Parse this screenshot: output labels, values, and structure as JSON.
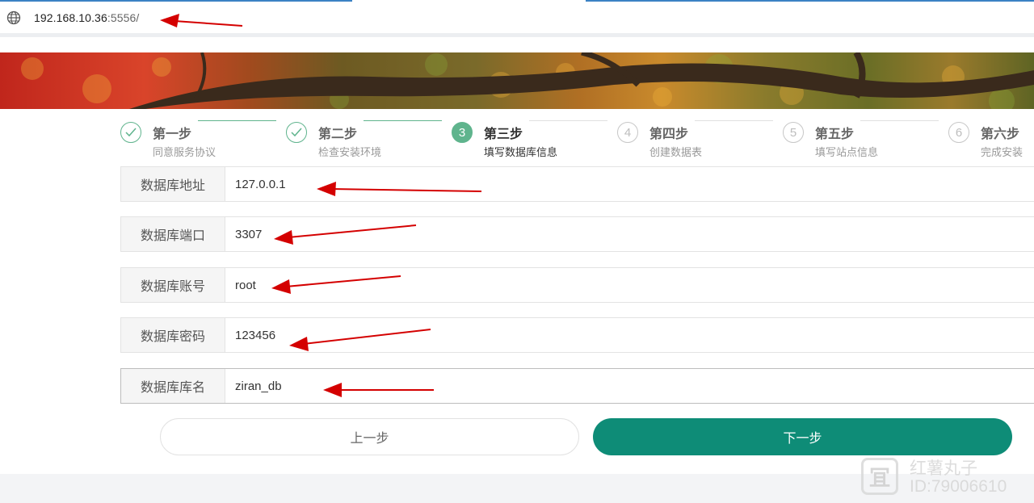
{
  "browser": {
    "url_host": "192.168.10.36",
    "url_port": ":5556/"
  },
  "steps": [
    {
      "number": "1",
      "title": "第一步",
      "subtitle": "同意服务协议",
      "status": "done"
    },
    {
      "number": "2",
      "title": "第二步",
      "subtitle": "检查安装环境",
      "status": "done"
    },
    {
      "number": "3",
      "title": "第三步",
      "subtitle": "填写数据库信息",
      "status": "current"
    },
    {
      "number": "4",
      "title": "第四步",
      "subtitle": "创建数据表",
      "status": "pending"
    },
    {
      "number": "5",
      "title": "第五步",
      "subtitle": "填写站点信息",
      "status": "pending"
    },
    {
      "number": "6",
      "title": "第六步",
      "subtitle": "完成安装",
      "status": "pending"
    }
  ],
  "form": {
    "host": {
      "label": "数据库地址",
      "value": "127.0.0.1"
    },
    "port": {
      "label": "数据库端口",
      "value": "3307"
    },
    "user": {
      "label": "数据库账号",
      "value": "root"
    },
    "password": {
      "label": "数据库密码",
      "value": "123456"
    },
    "dbname": {
      "label": "数据库库名",
      "value": "ziran_db"
    }
  },
  "buttons": {
    "prev_label": "上一步",
    "next_label": "下一步"
  },
  "colors": {
    "step_active": "#5fb48d",
    "primary_button": "#0e8c77",
    "annotation_arrow": "#d40000"
  },
  "watermark": {
    "logo_glyph": "冝",
    "name": "红薯丸子",
    "id": "ID:79006610"
  }
}
